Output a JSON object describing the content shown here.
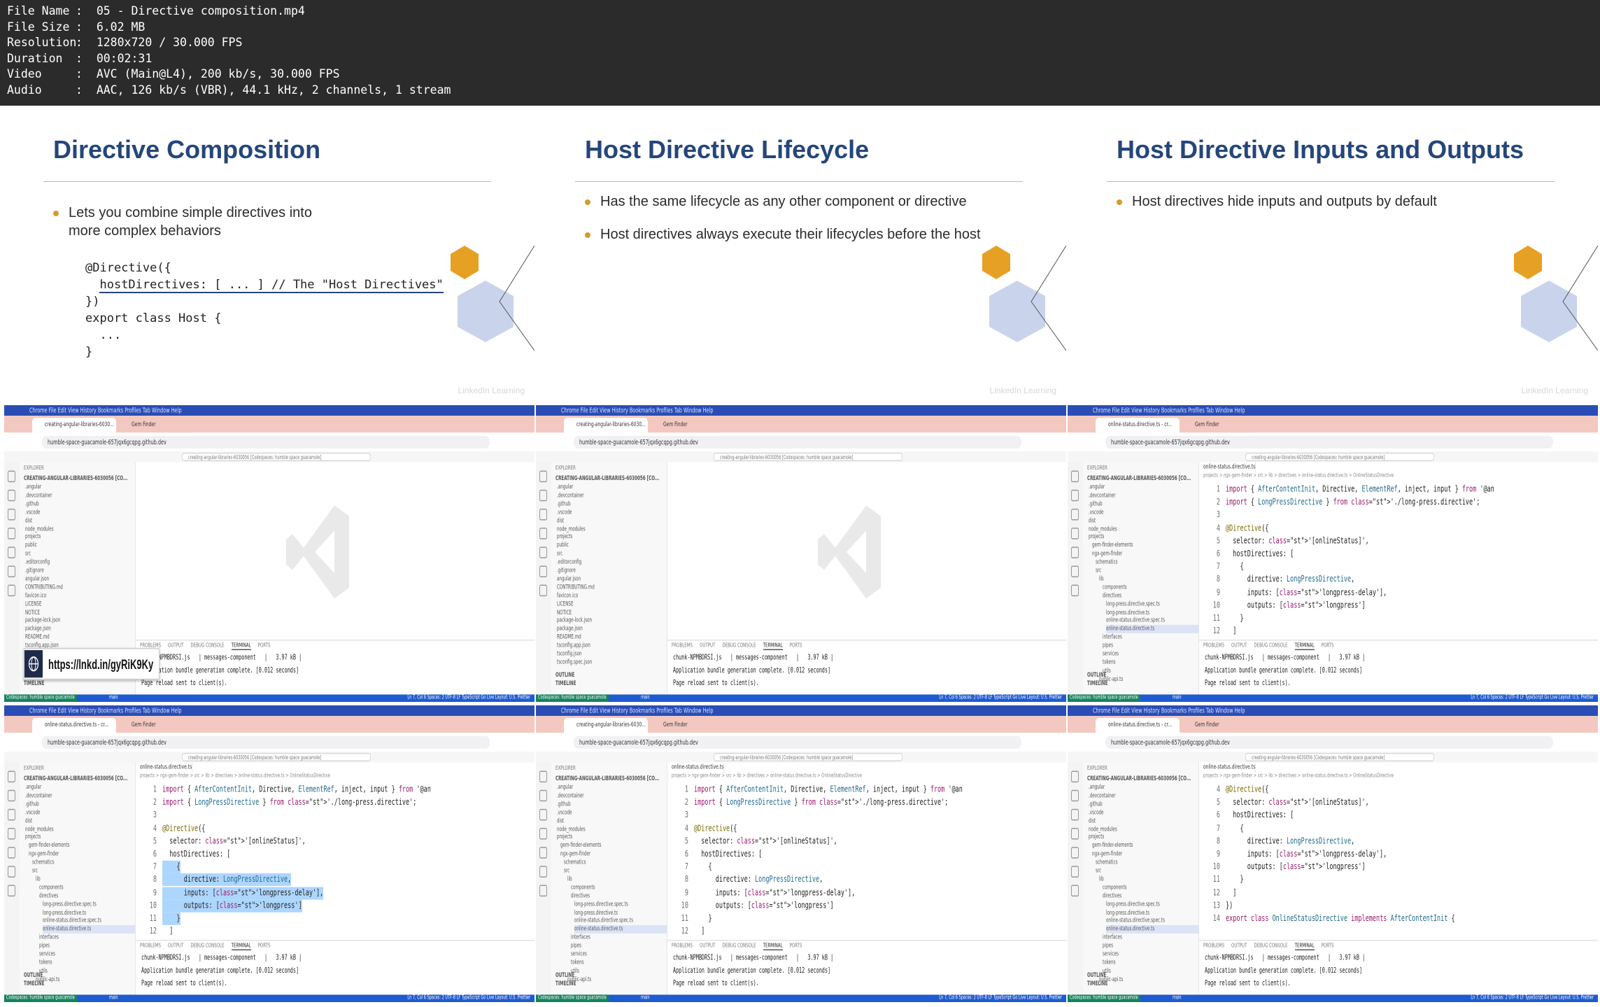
{
  "file_info": {
    "rows": [
      {
        "key": "File Name",
        "value": "05 - Directive composition.mp4"
      },
      {
        "key": "File Size",
        "value": "6.02 MB"
      },
      {
        "key": "Resolution",
        "value": "1280x720 / 30.000 FPS"
      },
      {
        "key": "Duration",
        "value": "00:02:31"
      },
      {
        "key": "Video",
        "value": "AVC (Main@L4), 200 kb/s, 30.000 FPS"
      },
      {
        "key": "Audio",
        "value": "AAC, 126 kb/s (VBR), 44.1 kHz, 2 channels, 1 stream"
      }
    ]
  },
  "slides": [
    {
      "title": "Directive Composition",
      "bullets": [
        "Lets you combine simple directives into",
        "more complex behaviors"
      ],
      "code": {
        "l1": "@Directive({",
        "l2": "hostDirectives: [ ... ] // The \"Host Directives\"",
        "l3": "})",
        "l4": "export class Host {",
        "l5": "  ...",
        "l6": "}"
      }
    },
    {
      "title": "Host Directive Lifecycle",
      "bullets": [
        "Has the same lifecycle as any other component or directive",
        "Host directives always execute their lifecycles before the host"
      ]
    },
    {
      "title": "Host Directive Inputs and Outputs",
      "bullets": [
        "Host directives hide inputs and outputs by default"
      ]
    }
  ],
  "watermark": "LinkedIn Learning",
  "browser": {
    "tab_main": "creating-angular-libraries-6030...",
    "tab_main_alt": "online-status.directive.ts - cr...",
    "tab_second": "Gem Finder",
    "url": "humble-space-guacamole-657jqx6gcqpg.github.dev",
    "command_center": "creating-angular-libraries-6030056 [Codespaces: humble space guacamole]",
    "menu": "Chrome  File  Edit  View  History  Bookmarks  Profiles  Tab  Window  Help"
  },
  "explorer": {
    "header": "EXPLORER",
    "root": "CREATING-ANGULAR-LIBRARIES-6030056 [CO...",
    "items_root": [
      ".angular",
      ".devcontainer",
      ".github",
      ".vscode",
      "dist",
      "node_modules",
      "projects",
      "public",
      "src",
      ".editorconfig",
      ".gitignore",
      "angular.json",
      "CONTRIBUTING.md",
      "favicon.ico",
      "LICENSE",
      "NOTICE",
      "package-lock.json",
      "package.json",
      "README.md",
      "tsconfig.app.json",
      "tsconfig.json",
      "tsconfig.spec.json"
    ],
    "items_tree": [
      ".angular",
      ".devcontainer",
      ".github",
      ".vscode",
      "dist",
      "node_modules",
      "projects",
      "gem-finder-elements",
      "ngx-gem-finder",
      "schematics",
      "src",
      "lib",
      "components",
      "directives",
      "long-press.directive.spec.ts",
      "long-press.directive.ts",
      "online-status.directive.spec.ts",
      "online-status.directive.ts",
      "interfaces",
      "pipes",
      "services",
      "tokens",
      "utils",
      "public-api.ts"
    ],
    "outline": "OUTLINE",
    "timeline": "TIMELINE"
  },
  "editor": {
    "tab": "online-status.directive.ts",
    "crumb": "projects > ngx-gem-finder > src > lib > directives > online-status.directive.ts > OnlineStatusDirective",
    "line_numbers": [
      "1",
      "2",
      "3",
      "4",
      "5",
      "6",
      "7",
      "8",
      "9",
      "10",
      "11",
      "12"
    ],
    "lines": [
      "import { AfterContentInit, Directive, ElementRef, inject, input } from '@an",
      "import { LongPressDirective } from './long-press.directive';",
      "",
      "@Directive({",
      "  selector: '[onlineStatus]',",
      "  hostDirectives: [",
      "    {",
      "      directive: LongPressDirective,",
      "      inputs: ['longpress-delay'],",
      "      outputs: ['longpress']",
      "    }",
      "  ]"
    ],
    "line_numbers_scrolled": [
      "4",
      "5",
      "6",
      "7",
      "8",
      "9",
      "10",
      "11",
      "12",
      "13",
      "14"
    ],
    "lines_scrolled": [
      "@Directive({",
      "  selector: '[onlineStatus]',",
      "  hostDirectives: [",
      "    {",
      "      directive: LongPressDirective,",
      "      inputs: ['longpress-delay'],",
      "      outputs: ['longpress']",
      "    }",
      "  ]",
      "})",
      "export class OnlineStatusDirective implements AfterContentInit {"
    ]
  },
  "panel": {
    "tabs": [
      "PROBLEMS",
      "OUTPUT",
      "DEBUG CONSOLE",
      "TERMINAL",
      "PORTS"
    ],
    "active_tab": "TERMINAL",
    "line1": "chunk-NPMBDRSI.js   | messages-component   |   3.97 kB |",
    "line2": "Application bundle generation complete. [0.012 seconds]",
    "line3": "Page reload sent to client(s)."
  },
  "statusbar": {
    "remote": "Codespaces: humble space guacamole",
    "branch": "main",
    "right": "Ln 7, Col 6   Spaces: 2   UTF-8   LF   TypeScript   Go Live   Layout: U.S.   Prettier"
  },
  "link_overlay": "https://lnkd.in/gyRiK9Ky",
  "colors": {
    "title_blue": "#25467a",
    "accent_orange": "#e6a023",
    "status_blue": "#1f5bd0",
    "selection": "#add6ff"
  }
}
